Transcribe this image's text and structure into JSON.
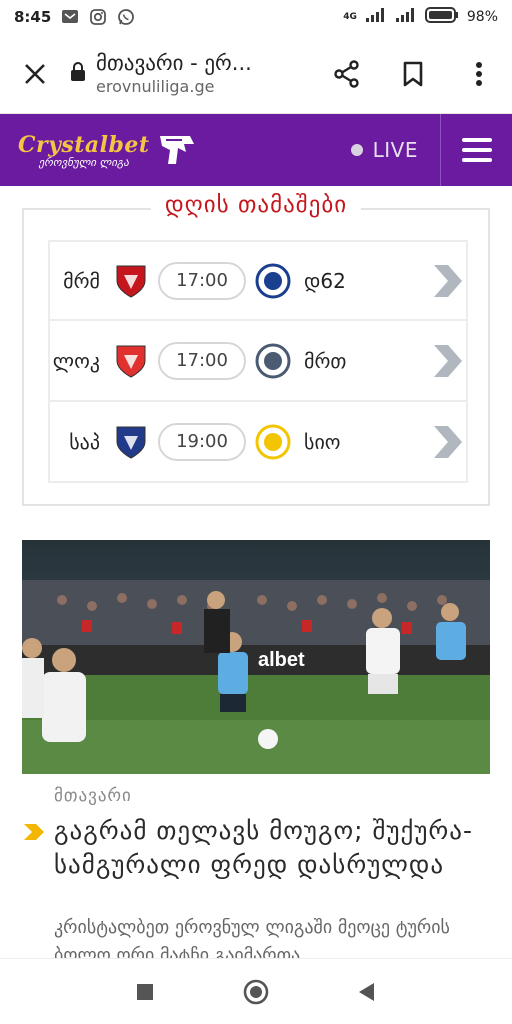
{
  "status_bar": {
    "time": "8:45",
    "network": "4G",
    "battery": "98%",
    "icons": [
      "message-icon",
      "instagram-icon",
      "whatsapp-icon"
    ]
  },
  "browser": {
    "page_title": "მთავარი - ერ...",
    "domain": "erovnuliliga.ge",
    "icons": [
      "close-icon",
      "lock-icon",
      "share-icon",
      "bookmark-icon",
      "more-vert-icon"
    ]
  },
  "header": {
    "logo_main": "Crystalbet",
    "logo_sub": "ეროვნული ლიგა",
    "live_label": "LIVE",
    "colors": {
      "background": "#6a1ba0",
      "logo": "#f5c443"
    }
  },
  "games": {
    "title": "დღის თამაშები",
    "matches": [
      {
        "home": "მრმ",
        "time": "17:00",
        "away": "დ62",
        "home_color": "#c4161c",
        "away_color": "#1b3f8f"
      },
      {
        "home": "ლოკ",
        "time": "17:00",
        "away": "მრთ",
        "home_color": "#e0312f",
        "away_color": "#4a5b72"
      },
      {
        "home": "საპ",
        "time": "19:00",
        "away": "სიო",
        "home_color": "#213a8a",
        "away_color": "#f2c500"
      }
    ]
  },
  "news": {
    "category": "მთავარი",
    "headline": "გაგრამ თელავს მოუგო; შუქურა-სამგურალი ფრედ დასრულდა",
    "excerpt": "კრისტალბეთ ეროვნულ ლიგაში მეოცე ტურის ბოლო ორი მატჩი გაიმართა",
    "image_banner_text": "albet"
  }
}
